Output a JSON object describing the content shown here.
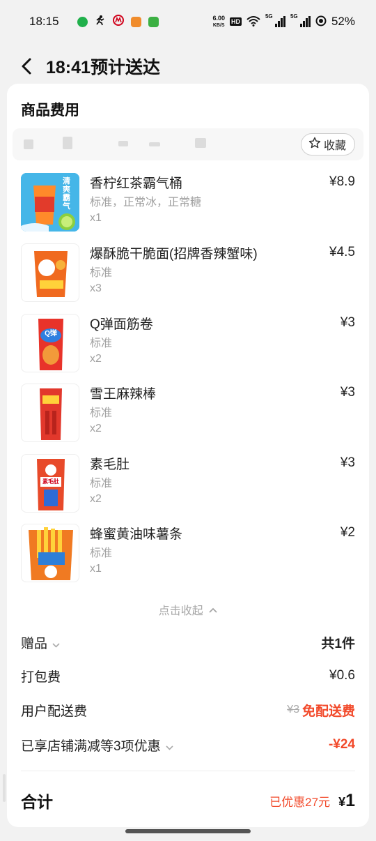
{
  "status_bar": {
    "time": "18:15",
    "net_speed_value": "6.00",
    "net_speed_unit": "KB/S",
    "hd_label": "HD",
    "sim1_label": "5G",
    "sim2_label": "5G",
    "battery": "52%"
  },
  "header": {
    "title": "18:41预计送达"
  },
  "section": {
    "title": "商品费用",
    "favorite_label": "收藏"
  },
  "products": [
    {
      "name": "香柠红茶霸气桶",
      "spec": "标准，正常冰，正常糖",
      "qty": "x1",
      "price": "¥8.9"
    },
    {
      "name": "爆酥脆干脆面(招牌香辣蟹味)",
      "spec": "标准",
      "qty": "x3",
      "price": "¥4.5"
    },
    {
      "name": "Q弹面筋卷",
      "spec": "标准",
      "qty": "x2",
      "price": "¥3"
    },
    {
      "name": "雪王麻辣棒",
      "spec": "标准",
      "qty": "x2",
      "price": "¥3"
    },
    {
      "name": "素毛肚",
      "spec": "标准",
      "qty": "x2",
      "price": "¥3"
    },
    {
      "name": "蜂蜜黄油味薯条",
      "spec": "标准",
      "qty": "x1",
      "price": "¥2"
    }
  ],
  "thumb_text": {
    "p0_a": "清爽",
    "p0_b": "霸气",
    "p2": "Q弹",
    "p4": "素毛肚"
  },
  "collapse_label": "点击收起",
  "fees": {
    "gift_label": "赠品",
    "gift_value": "共1件",
    "packing_label": "打包费",
    "packing_value": "¥0.6",
    "delivery_label": "用户配送费",
    "delivery_original": "¥3",
    "delivery_value": "免配送费",
    "discount_label": "已享店铺满减等3项优惠",
    "discount_value": "-¥24"
  },
  "total": {
    "label": "合计",
    "saved": "已优惠27元",
    "currency": "¥",
    "amount": "1"
  },
  "colors": {
    "accent_red": "#f2492a",
    "card_bg": "#ffffff",
    "page_bg": "#f2f2f2"
  }
}
